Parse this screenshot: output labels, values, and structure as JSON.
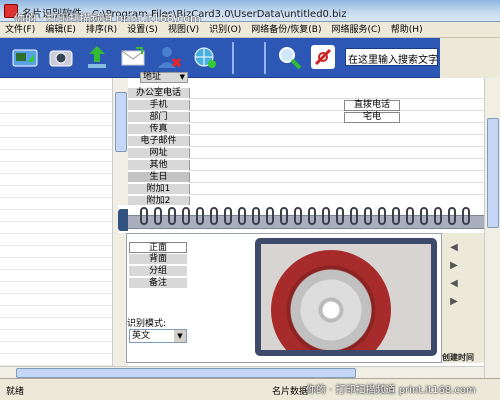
{
  "window": {
    "title": "名片识别软件 - C:\\Program Files\\BizCard3.0\\UserData\\untitled0.biz",
    "watermark_top": "你的 · 打印扫描频道  print.it168.com"
  },
  "menubar": {
    "items": [
      "文件(F)",
      "编辑(E)",
      "排序(R)",
      "设置(S)",
      "视图(V)",
      "识别(O)",
      "网络备份/恢复(B)",
      "网络服务(C)",
      "帮助(H)"
    ]
  },
  "toolbar": {
    "icons": [
      "scan-card-icon",
      "camera-icon",
      "import-icon",
      "mail-icon",
      "delete-user-icon",
      "network-icon",
      "search-icon",
      "card-tools-icon"
    ],
    "search_placeholder": "在这里输入搜索文字"
  },
  "fields": {
    "top_dropdown": "地址",
    "labels": [
      "办公室电话",
      "手机",
      "部门",
      "传真",
      "电子邮件",
      "网址",
      "其他",
      "生日",
      "附加1",
      "附加2"
    ],
    "extra_phone": "直拨电话",
    "extra_home": "宅电"
  },
  "card": {
    "sides": [
      "正面",
      "背面",
      "分组",
      "备注"
    ],
    "mode_label": "识别模式:",
    "mode_value": "英文",
    "corner_label": "创建时间"
  },
  "status": {
    "text": "就绪",
    "count": "名片数据",
    "watermark": "你的 · 打印扫描频道 print.it168.com"
  },
  "colors": {
    "toolbar_bg": "#2c57b5",
    "binder": "#a8aebd",
    "disc_red": "#a82b2b"
  }
}
